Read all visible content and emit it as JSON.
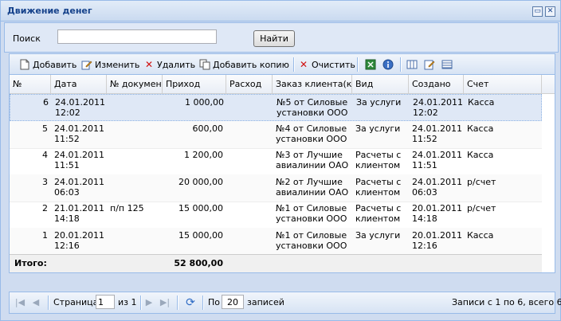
{
  "window": {
    "title": "Движение денег",
    "minimize_glyph": "▭",
    "close_glyph": "✕"
  },
  "search": {
    "label": "Поиск",
    "value": "",
    "placeholder": "",
    "button_label": "Найти"
  },
  "toolbar": {
    "add_label": "Добавить",
    "edit_label": "Изменить",
    "delete_label": "Удалить",
    "copy_label": "Добавить копию",
    "clear_label": "Очистить"
  },
  "grid": {
    "columns": [
      "№",
      "Дата",
      "№ документ",
      "Приход",
      "Расход",
      "Заказ клиента(кон",
      "Вид",
      "Создано",
      "Счет"
    ],
    "rows": [
      {
        "num": "6",
        "date": "24.01.2011 12:02",
        "doc": "",
        "income": "1 000,00",
        "expense": "",
        "order": "№5 от Силовые установки ООО",
        "kind": "За услуги",
        "created": "24.01.2011 12:02",
        "account": "Касса"
      },
      {
        "num": "5",
        "date": "24.01.2011 11:52",
        "doc": "",
        "income": "600,00",
        "expense": "",
        "order": "№4 от Силовые установки ООО",
        "kind": "За услуги",
        "created": "24.01.2011 11:52",
        "account": "Касса"
      },
      {
        "num": "4",
        "date": "24.01.2011 11:51",
        "doc": "",
        "income": "1 200,00",
        "expense": "",
        "order": "№3 от Лучшие авиалинии ОАО",
        "kind": "Расчеты с клиентом",
        "created": "24.01.2011 11:51",
        "account": "Касса"
      },
      {
        "num": "3",
        "date": "24.01.2011 06:03",
        "doc": "",
        "income": "20 000,00",
        "expense": "",
        "order": "№2 от Лучшие авиалинии ОАО",
        "kind": "Расчеты с клиентом",
        "created": "24.01.2011 06:03",
        "account": "р/счет"
      },
      {
        "num": "2",
        "date": "21.01.2011 14:18",
        "doc": "п/п 125",
        "income": "15 000,00",
        "expense": "",
        "order": "№1 от Силовые установки ООО",
        "kind": "Расчеты с клиентом",
        "created": "20.01.2011 14:18",
        "account": "р/счет"
      },
      {
        "num": "1",
        "date": "20.01.2011 12:16",
        "doc": "",
        "income": "15 000,00",
        "expense": "",
        "order": "№1 от Силовые установки ООО",
        "kind": "За услуги",
        "created": "20.01.2011 12:16",
        "account": "Касса"
      }
    ],
    "total_label": "Итого:",
    "total_value": "52 800,00"
  },
  "pager": {
    "page_label": "Страница",
    "page_value": "1",
    "of_label": "из 1",
    "per_label": "По",
    "per_value": "20",
    "records_label": "записей",
    "status": "Записи с 1 по 6, всего 6"
  }
}
